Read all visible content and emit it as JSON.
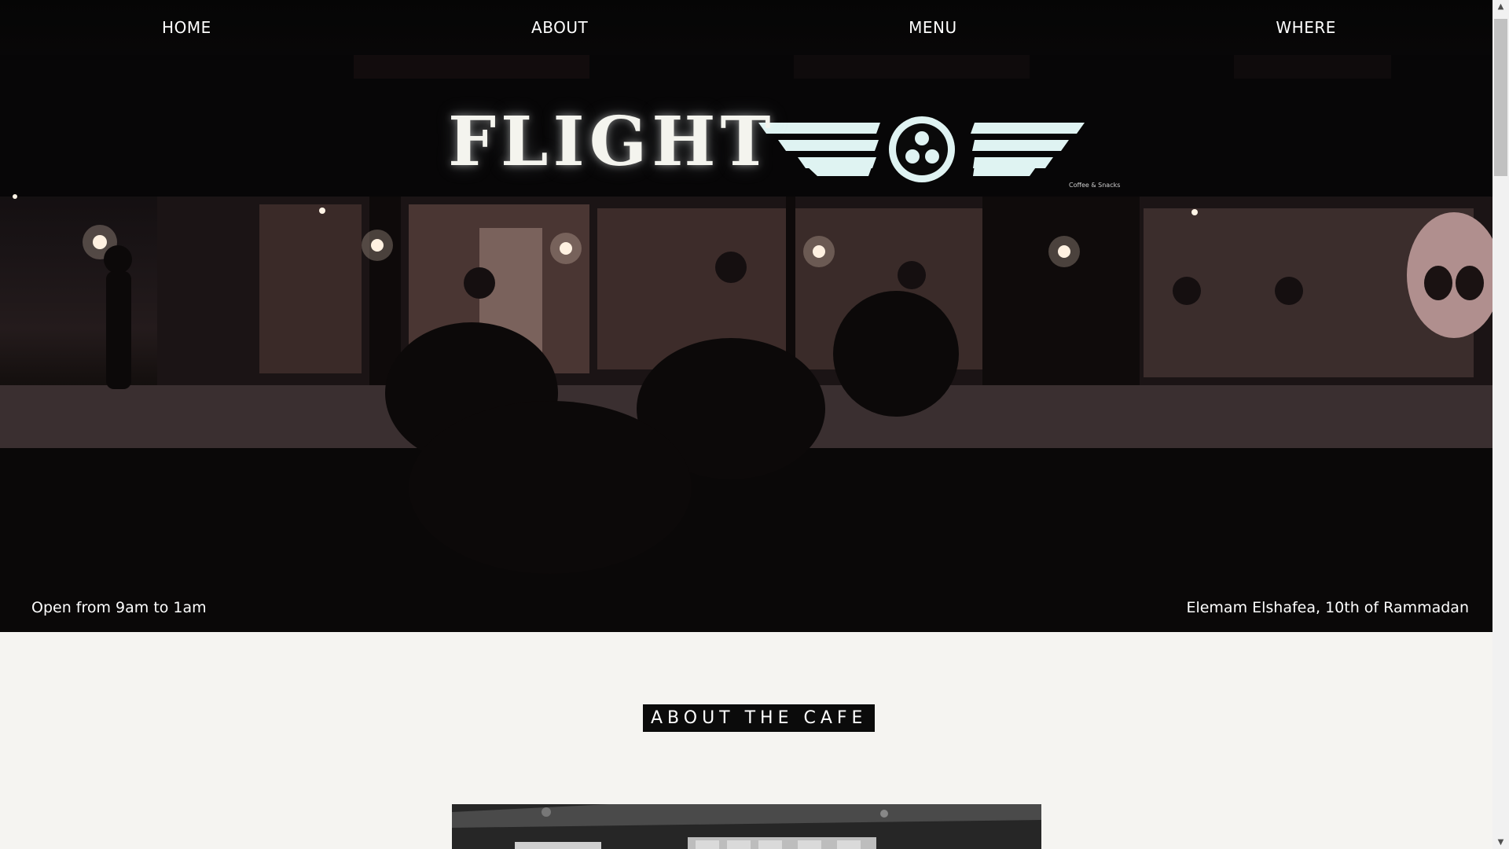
{
  "nav": {
    "items": [
      {
        "label": "HOME"
      },
      {
        "label": "ABOUT"
      },
      {
        "label": "MENU"
      },
      {
        "label": "WHERE"
      }
    ]
  },
  "hero": {
    "sign_text": "FLIGHT",
    "sign_subtext": "Coffee & Snacks",
    "hours": "Open from 9am to 1am",
    "address": "Elemam Elshafea, 10th of Rammadan"
  },
  "about": {
    "title": "ABOUT THE CAFE"
  },
  "colors": {
    "nav_text": "#ffffff",
    "hero_dark": "#050505",
    "page_bg": "#f5f4f1",
    "about_label_bg": "#0b0b0b",
    "sign_glow": "#dff3f2"
  },
  "icons": {
    "scroll_up": "triangle-up",
    "scroll_down": "triangle-down",
    "sign_logo": "propeller-wings"
  }
}
